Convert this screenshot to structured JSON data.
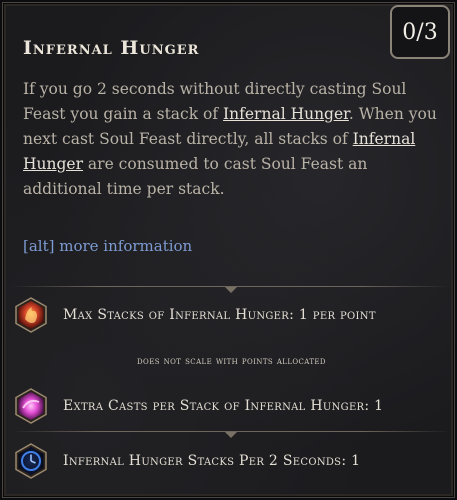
{
  "skill": {
    "title": "Infernal Hunger",
    "points": "0/3"
  },
  "description": {
    "part1": "If you go 2 seconds without directly casting Soul Feast you gain a stack of ",
    "keyword1": "Infernal Hunger",
    "part2": ". When you next cast Soul Feast directly, all stacks of ",
    "keyword2": "Infernal Hunger",
    "part3": " are consumed to cast Soul Feast an additional time per stack."
  },
  "alt_hint": "[alt] more information",
  "stats": [
    {
      "label": "Max Stacks of Infernal Hunger: 1 per point",
      "icon": "fire-creature-icon",
      "color": "#d4442a"
    },
    {
      "label": "Extra Casts per Stack of Infernal Hunger: 1",
      "icon": "pink-orb-icon",
      "color": "#e44fd6"
    },
    {
      "label": "Infernal Hunger Stacks Per 2 Seconds: 1",
      "icon": "blue-clock-icon",
      "color": "#3f7fe6"
    }
  ],
  "scaling_note": "does not scale with points allocated"
}
